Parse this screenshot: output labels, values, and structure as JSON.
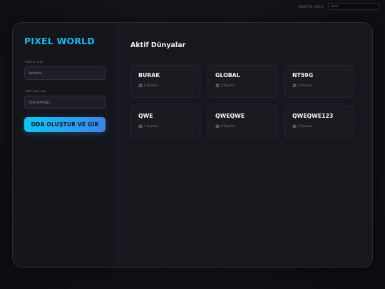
{
  "topbar": {
    "label": "YÖNETİCİ GİRİŞİ",
    "code_placeholder": "Kod..."
  },
  "sidebar": {
    "logo": "PIXEL WORLD",
    "profile_label": "PROFİL İSMİ",
    "profile_placeholder": "İsminiz...",
    "room_label": "YENİ ODA ADI",
    "room_placeholder": "Oda ismi(ğ)...",
    "cta_label": "ODA OLUŞTUR VE GİR"
  },
  "main": {
    "title": "Aktif Dünyalar",
    "worlds": [
      {
        "name": "BURAK",
        "players": "0 Oyuncu"
      },
      {
        "name": "GLOBAL",
        "players": "0 Oyuncu"
      },
      {
        "name": "NT59G",
        "players": "0 Oyuncu"
      },
      {
        "name": "QWE",
        "players": "1 Oyuncu"
      },
      {
        "name": "QWEQWE",
        "players": "0 Oyuncu"
      },
      {
        "name": "QWEQWE123",
        "players": "0 Oyuncu"
      }
    ]
  },
  "colors": {
    "accent": "#19b7f0",
    "cta_start": "#10c6f2",
    "cta_end": "#3f84e6",
    "panel": "#17181e"
  },
  "icons": {
    "players": "users-icon"
  }
}
